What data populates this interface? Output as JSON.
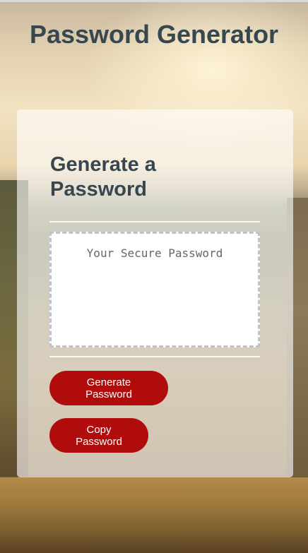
{
  "header": {
    "title": "Password Generator"
  },
  "card": {
    "heading": "Generate a Password",
    "password_field": {
      "value": "",
      "placeholder": "Your Secure Password"
    },
    "buttons": {
      "generate_label": "Generate Password",
      "copy_label": "Copy Password"
    }
  },
  "colors": {
    "title_text": "#37474f",
    "button_background": "#b10c0c",
    "button_text": "#ffffff"
  }
}
